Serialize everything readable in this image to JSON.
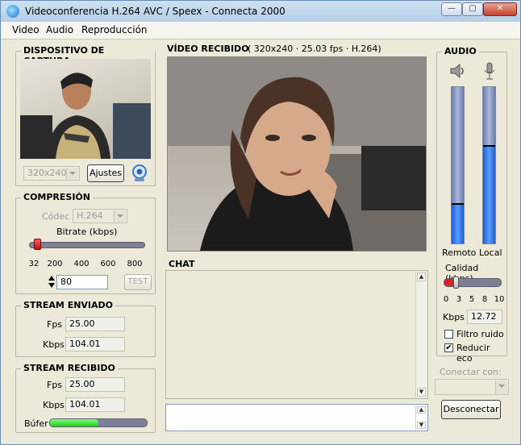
{
  "window": {
    "title": "Videoconferencia H.264 AVC / Speex - Connecta 2000"
  },
  "menu": {
    "items": [
      "Video",
      "Audio",
      "Reproducción"
    ]
  },
  "capture": {
    "title": "DISPOSITIVO DE CAPTURA",
    "resolution": "320x240",
    "settings_label": "Ajustes"
  },
  "compression": {
    "title": "COMPRESIÓN",
    "codec_label": "Códec",
    "codec_value": "H.264",
    "bitrate_label": "Bitrate (kbps)",
    "ticks": [
      "32",
      "200",
      "400",
      "600",
      "800"
    ],
    "bitrate_value": "80",
    "test_label": "TEST",
    "bitrate_level": 0.06
  },
  "sent": {
    "title": "STREAM ENVIADO",
    "fps_label": "Fps",
    "fps_value": "25.00",
    "kbps_label": "Kbps",
    "kbps_value": "104.01"
  },
  "received": {
    "title": "STREAM RECIBIDO",
    "fps_label": "Fps",
    "fps_value": "25.00",
    "kbps_label": "Kbps",
    "kbps_value": "104.01",
    "buffer_label": "Búfer",
    "buffer_level": 0.5
  },
  "video": {
    "title": "VÍDEO RECIBIDO",
    "info": "( 320x240 · 25.03 fps · H.264)"
  },
  "chat": {
    "title": "CHAT"
  },
  "audio": {
    "title": "AUDIO",
    "remote_label": "Remoto",
    "local_label": "Local",
    "remote_level": 0.25,
    "local_level": 0.62,
    "quality_label": "Calidad (kbps)",
    "quality_ticks": [
      "0",
      "3",
      "5",
      "8",
      "10"
    ],
    "quality_level": 0.2,
    "kbps_label": "Kbps",
    "kbps_value": "12.72",
    "noise_filter_label": "Filtro ruido",
    "noise_filter_checked": false,
    "echo_label": "Reducir eco",
    "echo_checked": true
  },
  "connect": {
    "label": "Conectar con:",
    "value": "",
    "disconnect_label": "Desconectar"
  },
  "colors": {
    "meter_blue": "#2f7cf0",
    "buffer_green": "#39e03a",
    "quality_red": "#e02020"
  }
}
